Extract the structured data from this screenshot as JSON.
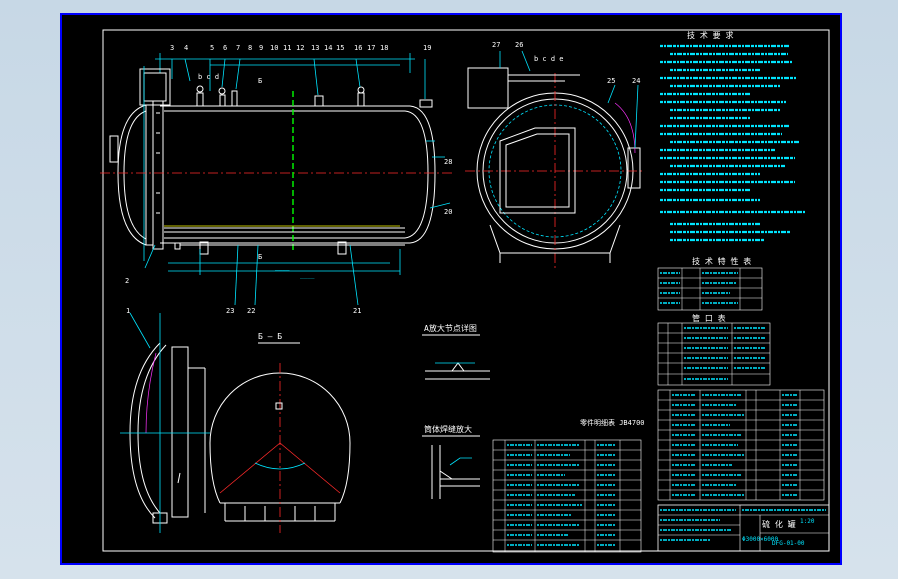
{
  "drawing": {
    "background": "#000000",
    "border_color": "#0000ff",
    "line_colors": {
      "outline": "#ffffff",
      "dimension": "#00e5ff",
      "center": "#ff2a2a",
      "section": "#00ff00",
      "leader": "#ffff00"
    },
    "top_labels": [
      "3",
      "4",
      "5",
      "6",
      "7",
      "8",
      "9",
      "10",
      "11",
      "12",
      "13",
      "14",
      "15",
      "16",
      "17",
      "18",
      "19"
    ],
    "side_labels": {
      "l27": "27",
      "l26": "26",
      "l25": "25",
      "l24": "24",
      "l28": "28",
      "l20": "20",
      "l2": "2",
      "l23": "23",
      "l22": "22",
      "l21": "21",
      "l1": "1"
    },
    "letters_a": "b c d",
    "letters_b": "b c d e",
    "section_mark": "Б",
    "section_view_label": "Б — Б",
    "detail_label_1": "A放大节点详图",
    "detail_label_2": "筒体焊缝放大",
    "parts_title": "零件明细表  JB4700",
    "tech_title": "技 术 要 求",
    "table_title_1": "技 术 特 性 表",
    "table_title_2": "管 口 表",
    "title_block": {
      "name": "硫 化 罐",
      "sub": "Φ3000×6000",
      "drawing_no": "DFG-01-00",
      "scale": "1:20"
    }
  }
}
